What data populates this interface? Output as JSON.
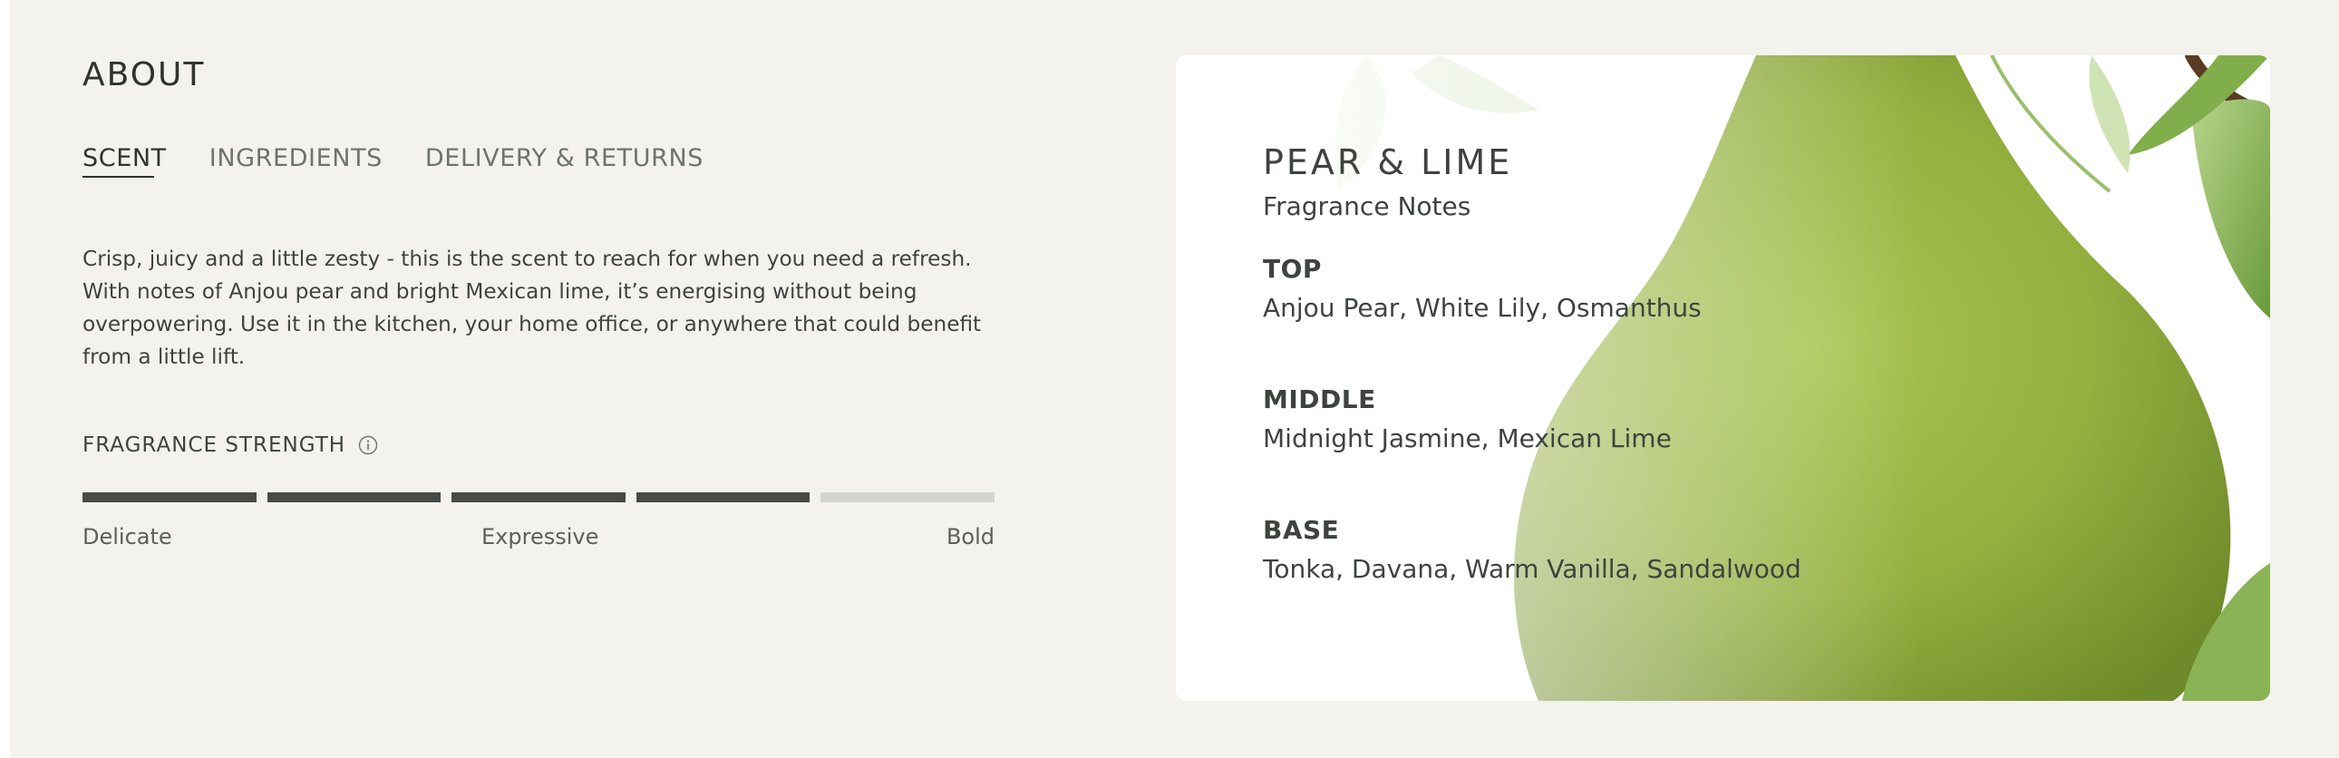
{
  "section_title": "ABOUT",
  "tabs": [
    {
      "label": "SCENT",
      "active": true
    },
    {
      "label": "INGREDIENTS",
      "active": false
    },
    {
      "label": "DELIVERY & RETURNS",
      "active": false
    }
  ],
  "description": "Crisp, juicy and a little zesty - this is the scent to reach for when you need a refresh. With notes of Anjou pear and bright Mexican lime, it’s energising without being overpowering. Use it in the kitchen, your home office, or anywhere that could benefit from a little lift.",
  "strength": {
    "label": "FRAGRANCE STRENGTH",
    "info_icon": "info-circle-icon",
    "level": 4,
    "max": 5,
    "scale_labels": {
      "low": "Delicate",
      "mid": "Expressive",
      "high": "Bold"
    },
    "filled_color": "#474a46",
    "empty_color": "#d3d6cc"
  },
  "card": {
    "title": "PEAR & LIME",
    "subtitle": "Fragrance Notes",
    "notes": [
      {
        "heading": "TOP",
        "value": "Anjou Pear, White Lily, Osmanthus"
      },
      {
        "heading": "MIDDLE",
        "value": "Midnight Jasmine, Mexican Lime"
      },
      {
        "heading": "BASE",
        "value": "Tonka, Davana, Warm Vanilla, Sandalwood"
      }
    ],
    "image": "pear-with-leaves-photo"
  },
  "colors": {
    "page_bg": "#f3f2ed",
    "text": "#3f433f",
    "pear_green": "#9ab545"
  }
}
